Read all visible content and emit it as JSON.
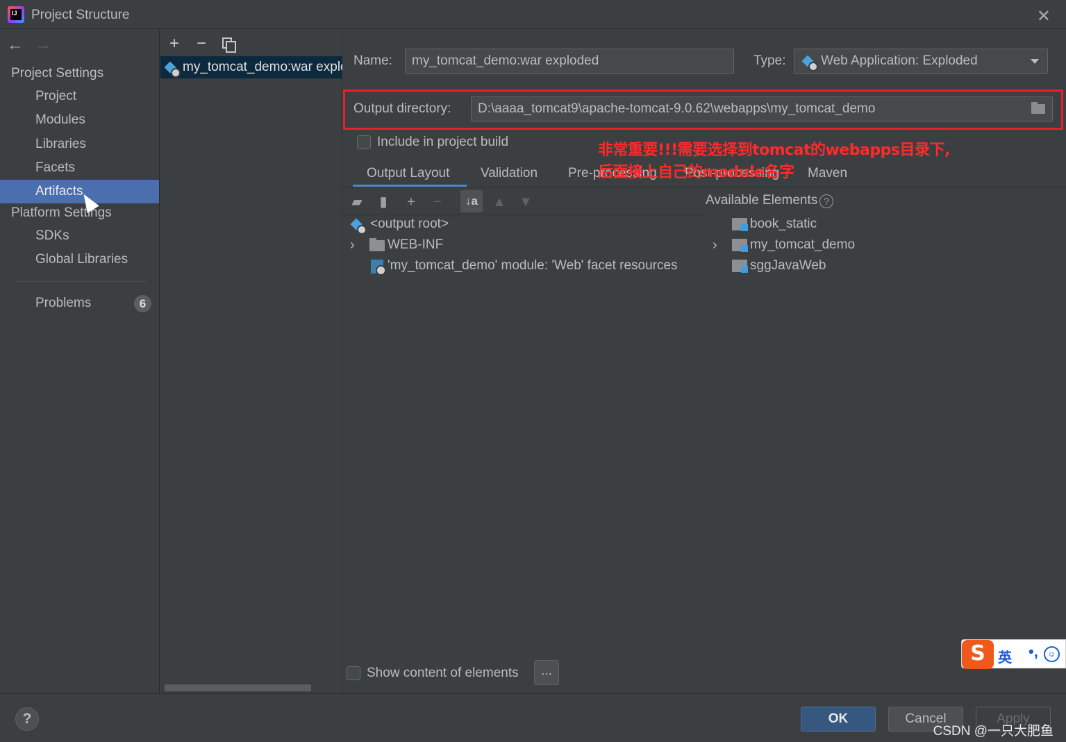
{
  "window": {
    "title": "Project Structure"
  },
  "sidebar": {
    "sections": [
      {
        "label": "Project Settings",
        "items": [
          "Project",
          "Modules",
          "Libraries",
          "Facets",
          "Artifacts"
        ]
      },
      {
        "label": "Platform Settings",
        "items": [
          "SDKs",
          "Global Libraries"
        ]
      }
    ],
    "selected": "Artifacts",
    "problems_label": "Problems",
    "problems_count": "6"
  },
  "artifacts_list": {
    "items": [
      "my_tomcat_demo:war exploded"
    ]
  },
  "artifact": {
    "name_label": "Name:",
    "name_value": "my_tomcat_demo:war exploded",
    "type_label": "Type:",
    "type_value": "Web Application: Exploded",
    "output_dir_label": "Output directory:",
    "output_dir_value": "D:\\aaaa_tomcat9\\apache-tomcat-9.0.62\\webapps\\my_tomcat_demo",
    "include_build_label": "Include in project build",
    "include_build_checked": false
  },
  "annotation": {
    "line1": "非常重要!!!需要选择到tomcat的webapps目录下,",
    "line2": "后面接上自己的module名字",
    "color": "#ff2a2a"
  },
  "tabs": [
    "Output Layout",
    "Validation",
    "Pre-processing",
    "Post-processing",
    "Maven"
  ],
  "active_tab": "Output Layout",
  "output_tree": {
    "root": "<output root>",
    "items": [
      "WEB-INF",
      "'my_tomcat_demo' module: 'Web' facet resources"
    ]
  },
  "available": {
    "label": "Available Elements",
    "items": [
      "book_static",
      "my_tomcat_demo",
      "sggJavaWeb"
    ]
  },
  "show_content_label": "Show content of elements",
  "dots_label": "...",
  "footer": {
    "ok": "OK",
    "cancel": "Cancel",
    "apply": "Apply",
    "watermark": "CSDN @一只大肥鱼"
  },
  "ime": {
    "logo": "S",
    "lang": "英",
    "punct": "•,",
    "emoji": "☺"
  },
  "colors": {
    "accent": "#4b6eaf",
    "selection": "#0d293e",
    "primary_button": "#365880",
    "highlight_box": "#e8202a"
  }
}
